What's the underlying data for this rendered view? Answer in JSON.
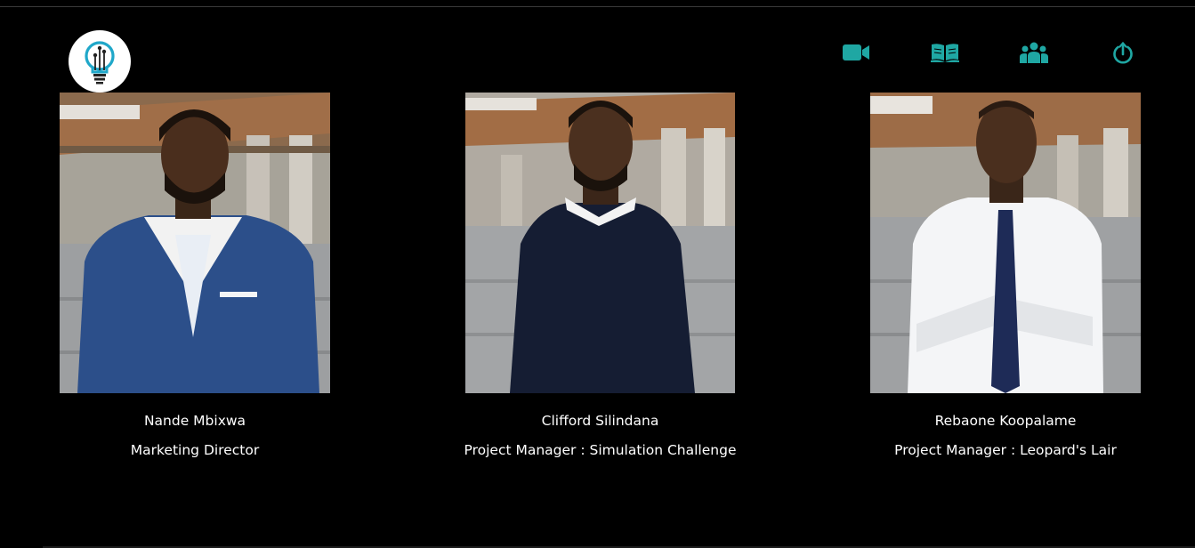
{
  "header": {
    "logo_icon": "lightbulb-circuit-icon",
    "nav": [
      {
        "icon": "video-camera-icon"
      },
      {
        "icon": "open-book-icon"
      },
      {
        "icon": "people-group-icon"
      },
      {
        "icon": "power-icon"
      }
    ]
  },
  "team": [
    {
      "name": "Nande Mbixwa",
      "role": "Marketing Director"
    },
    {
      "name": "Clifford Silindana",
      "role": "Project Manager : Simulation Challenge"
    },
    {
      "name": "Rebaone Koopalame",
      "role": "Project Manager : Leopard's Lair"
    }
  ],
  "colors": {
    "background": "#000000",
    "accent": "#1fa7a3",
    "text": "#ffffff"
  }
}
